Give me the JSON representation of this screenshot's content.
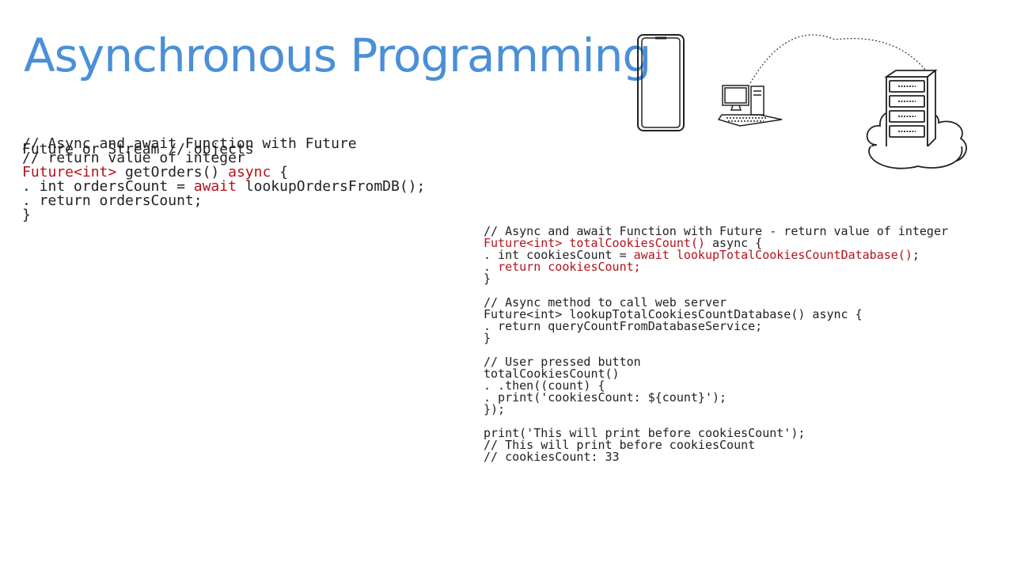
{
  "title": "Asynchronous Programming",
  "colors": {
    "title": "#4a8fd8",
    "keyword": "#b5121b",
    "text": "#222222"
  },
  "left_code": {
    "subtitle": "Future or Stream // objects",
    "lines": [
      [
        {
          "t": "// Async and await Function with Future"
        }
      ],
      [
        {
          "t": "// return value of integer"
        }
      ],
      [
        {
          "t": "Future<int>",
          "k": 1
        },
        {
          "t": " getOrders() "
        },
        {
          "t": "async",
          "k": 1
        },
        {
          "t": " {"
        }
      ],
      [
        {
          "t": ". int ordersCount = "
        },
        {
          "t": "await",
          "k": 1
        },
        {
          "t": " lookupOrdersFromDB();"
        }
      ],
      [
        {
          "t": ". return ordersCount;"
        }
      ],
      [
        {
          "t": "}"
        }
      ]
    ]
  },
  "right_code": {
    "lines": [
      [
        {
          "t": "// Async and await Function with Future - return value of integer"
        }
      ],
      [
        {
          "t": "Future<int>",
          "k": 1
        },
        {
          "t": " "
        },
        {
          "t": "totalCookiesCount()",
          "k": 1
        },
        {
          "t": " async {"
        }
      ],
      [
        {
          "t": ". int cookiesCount = "
        },
        {
          "t": "await lookupTotalCookiesCountDatabase()",
          "k": 1
        },
        {
          "t": ";"
        }
      ],
      [
        {
          "t": ". "
        },
        {
          "t": "return cookiesCount;",
          "k": 1
        }
      ],
      [
        {
          "t": "}"
        }
      ],
      [
        {
          "t": ""
        }
      ],
      [
        {
          "t": "// Async method to call web server"
        }
      ],
      [
        {
          "t": "Future<int> lookupTotalCookiesCountDatabase() async {"
        }
      ],
      [
        {
          "t": ". return queryCountFromDatabaseService;"
        }
      ],
      [
        {
          "t": "}"
        }
      ],
      [
        {
          "t": ""
        }
      ],
      [
        {
          "t": "// User pressed button"
        }
      ],
      [
        {
          "t": "totalCookiesCount()"
        }
      ],
      [
        {
          "t": ". .then((count) {"
        }
      ],
      [
        {
          "t": ". print('cookiesCount: ${count}');"
        }
      ],
      [
        {
          "t": "});"
        }
      ],
      [
        {
          "t": ""
        }
      ],
      [
        {
          "t": "print('This will print before cookiesCount');"
        }
      ],
      [
        {
          "t": "// This will print before cookiesCount"
        }
      ],
      [
        {
          "t": "// cookiesCount: 33"
        }
      ]
    ]
  },
  "illustration": {
    "icons": [
      "smartphone-icon",
      "desktop-computer-icon",
      "cloud-server-icon",
      "dotted-arc-connection"
    ]
  }
}
